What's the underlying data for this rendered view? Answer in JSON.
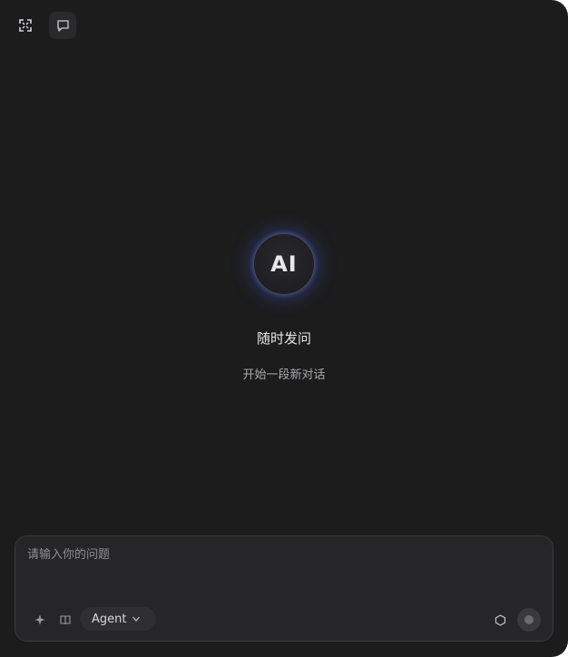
{
  "toolbar": {
    "fullscreen_icon": "expand-icon",
    "new_chat_icon": "chat-bubble-icon"
  },
  "hero": {
    "logo_text": "AI",
    "title": "随时发问",
    "subtitle": "开始一段新对话"
  },
  "composer": {
    "placeholder": "请输入你的问题",
    "value": "",
    "mode": "Agent",
    "tools": [
      "sparkle-icon",
      "book-icon",
      "cube-icon"
    ],
    "send_icon": "send-icon"
  },
  "colors": {
    "background": "#1c1c1d",
    "composer_bg": "#262628",
    "accent_glow": "#465ac8"
  }
}
